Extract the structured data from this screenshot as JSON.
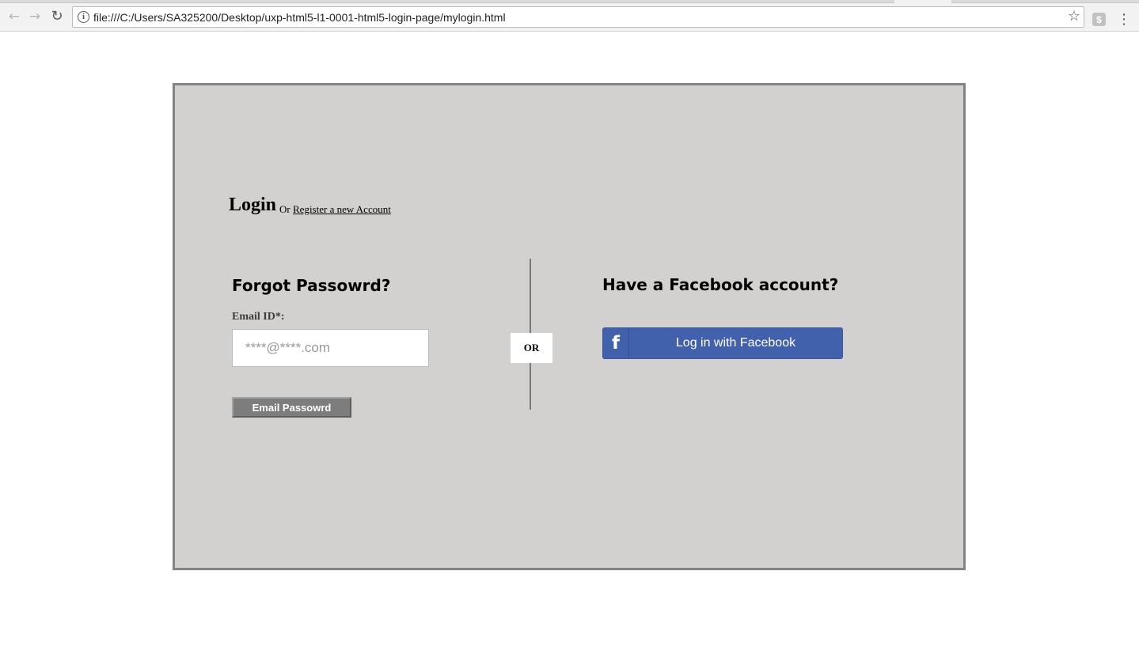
{
  "browser": {
    "back_icon": "←",
    "forward_icon": "→",
    "reload_icon": "↻",
    "info_icon": "i",
    "url": "file:///C:/Users/SA325200/Desktop/uxp-html5-l1-0001-html5-login-page/mylogin.html",
    "bookmark_icon": "☆",
    "extension_icon": "$",
    "menu_icon": "⋮"
  },
  "page": {
    "heading": "Login",
    "or_text": "Or",
    "register_link": "Register a new Account",
    "forgot": {
      "title": "Forgot Passowrd?",
      "email_label": "Email ID*:",
      "email_placeholder": "****@****.com",
      "email_value": "",
      "submit_label": "Email Passowrd"
    },
    "separator_label": "OR",
    "facebook": {
      "title": "Have a Facebook account?",
      "icon": "f",
      "button_label": "Log in with Facebook"
    }
  }
}
